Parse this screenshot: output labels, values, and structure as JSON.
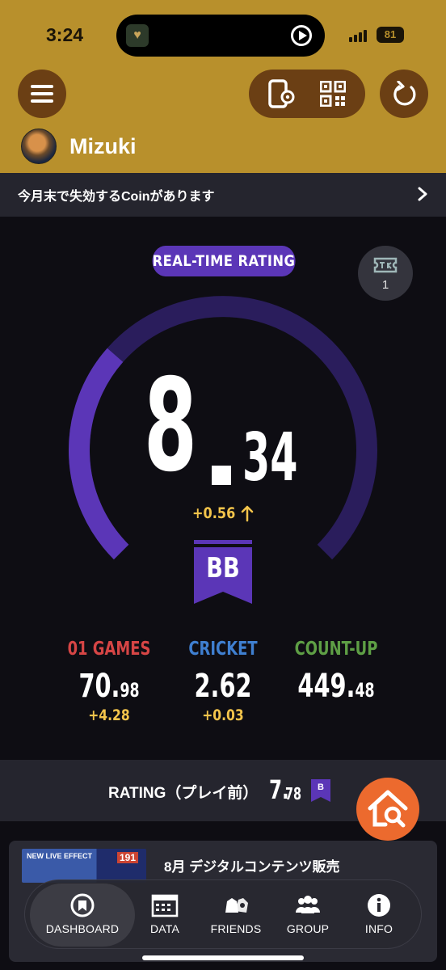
{
  "status_bar": {
    "time": "3:24",
    "battery": "81"
  },
  "header": {
    "username": "Mizuki"
  },
  "notice": {
    "text": "今月末で失効するCoinがあります"
  },
  "rating": {
    "badge": "REAL-TIME RATING",
    "ticket_count": "1",
    "integer": "8",
    "decimal": "34",
    "delta": "+0.56",
    "rank": "BB",
    "gauge_fill_fraction": 0.16
  },
  "stats": [
    {
      "title": "01 GAMES",
      "int": "70.",
      "dec": "98",
      "delta": "+4.28",
      "color": "#d64545"
    },
    {
      "title": "CRICKET",
      "int": "2.62",
      "dec": "",
      "delta": "+0.03",
      "color": "#3f7fd0"
    },
    {
      "title": "COUNT-UP",
      "int": "449.",
      "dec": "48",
      "delta": "",
      "color": "#5e9e45"
    }
  ],
  "bottom_rating": {
    "label": "RATING（プレイ前）",
    "int": "7.",
    "dec": "78",
    "rank": "B"
  },
  "banner": {
    "thumb_text": "NEW LIVE EFFECT",
    "thumb_badge": "191",
    "title": "8月 デジタルコンテンツ販売"
  },
  "tabs": [
    {
      "label": "DASHBOARD",
      "icon": "dashboard-icon"
    },
    {
      "label": "DATA",
      "icon": "calendar-icon"
    },
    {
      "label": "FRIENDS",
      "icon": "friends-icon"
    },
    {
      "label": "GROUP",
      "icon": "group-icon"
    },
    {
      "label": "INFO",
      "icon": "info-icon"
    }
  ],
  "colors": {
    "header_gold": "#b8902c",
    "accent_purple": "#5b36b7",
    "delta_yellow": "#f3c44b",
    "fab_orange": "#ec6a2e"
  }
}
